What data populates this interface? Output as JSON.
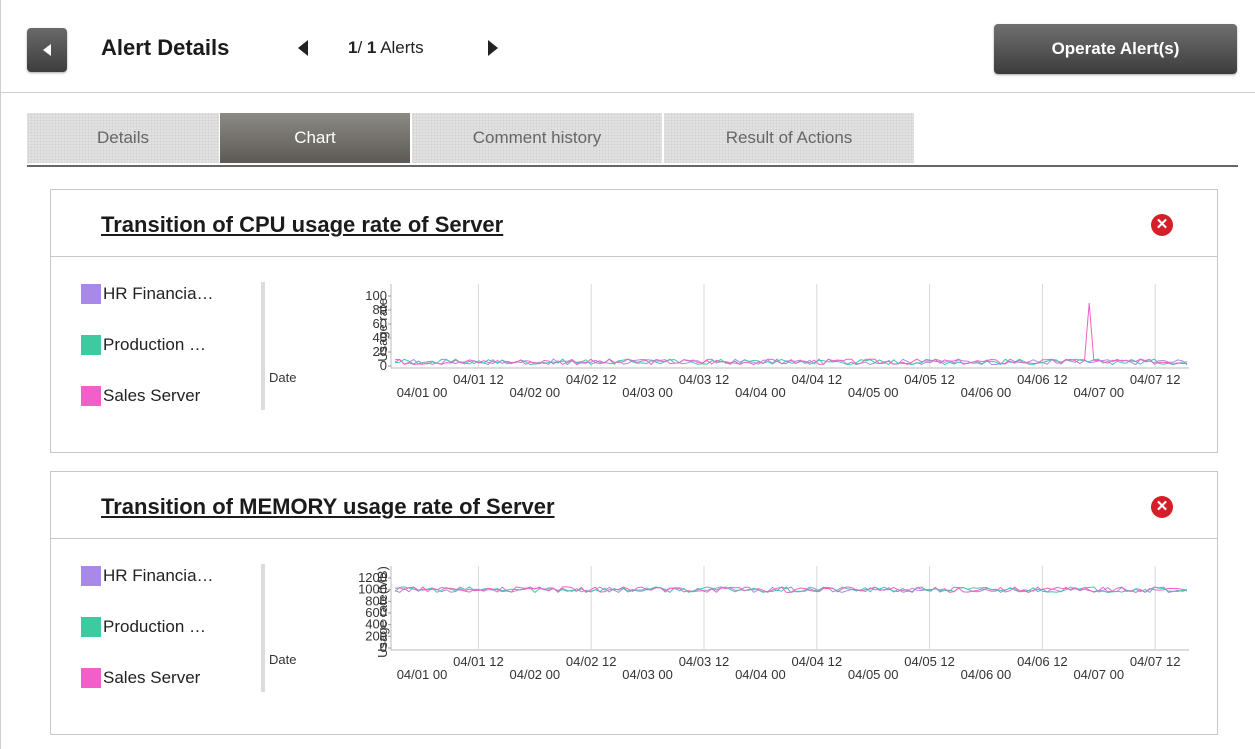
{
  "header": {
    "back_icon": "chevron-left-icon",
    "title": "Alert Details",
    "counter_current": "1",
    "counter_sep": "/ ",
    "counter_total": "1",
    "counter_unit": "Alerts",
    "operate_button": "Operate Alert(s)"
  },
  "tabs": [
    {
      "label": "Details"
    },
    {
      "label": "Chart"
    },
    {
      "label": "Comment history"
    },
    {
      "label": "Result of Actions"
    }
  ],
  "panels": [
    {
      "title": "Transition of CPU usage rate of Server",
      "close_icon": "close-icon"
    },
    {
      "title": "Transition of MEMORY usage rate of Server",
      "close_icon": "close-icon"
    }
  ],
  "colors": {
    "hr": "#a889e8",
    "production": "#3ec9a0",
    "sales": "#f060c8",
    "close": "#d41f2a"
  },
  "chart_data": [
    {
      "type": "line",
      "title": "Transition of CPU usage rate of Server",
      "xlabel": "Date",
      "ylabel": "Usage rate",
      "yticks": [
        0,
        20,
        40,
        60,
        80,
        100
      ],
      "ylim": [
        0,
        100
      ],
      "x_tick_labels": [
        "04/01 00",
        "04/01 12",
        "04/02 00",
        "04/02 12",
        "04/03 00",
        "04/03 12",
        "04/04 00",
        "04/04 12",
        "04/05 00",
        "04/05 12",
        "04/06 00",
        "04/06 12",
        "04/07 00",
        "04/07 12"
      ],
      "series": [
        {
          "name": "HR Financia…",
          "color": "#a889e8",
          "baseline": 6,
          "spike": null
        },
        {
          "name": "Production …",
          "color": "#3ec9a0",
          "baseline": 6,
          "spike": null
        },
        {
          "name": "Sales Server",
          "color": "#f060c8",
          "baseline": 6,
          "spike": {
            "at": "04/06 22",
            "value": 90
          }
        }
      ],
      "legend": "left"
    },
    {
      "type": "line",
      "title": "Transition of MEMORY usage rate of Server",
      "xlabel": "Date",
      "ylabel": "Usage rate(MB)",
      "yticks": [
        0,
        200,
        400,
        600,
        800,
        1000,
        1200
      ],
      "ylim": [
        0,
        1200
      ],
      "x_tick_labels": [
        "04/01 00",
        "04/01 12",
        "04/02 00",
        "04/02 12",
        "04/03 00",
        "04/03 12",
        "04/04 00",
        "04/04 12",
        "04/05 00",
        "04/05 12",
        "04/06 00",
        "04/06 12",
        "04/07 00",
        "04/07 12"
      ],
      "series": [
        {
          "name": "HR Financia…",
          "color": "#a889e8",
          "baseline": 1000,
          "spike": null
        },
        {
          "name": "Production …",
          "color": "#3ec9a0",
          "baseline": 1000,
          "spike": null
        },
        {
          "name": "Sales Server",
          "color": "#f060c8",
          "baseline": 1000,
          "spike": null
        }
      ],
      "legend": "left"
    }
  ]
}
